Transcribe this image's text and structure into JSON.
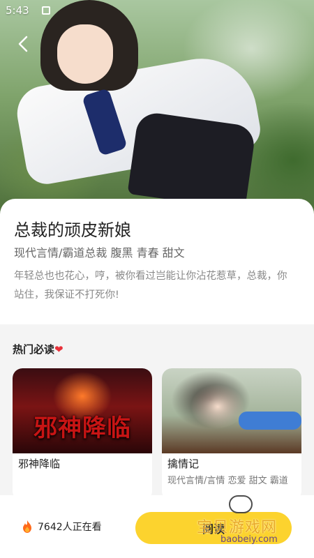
{
  "status_bar": {
    "time": "5:43"
  },
  "book": {
    "title": "总裁的顽皮新娘",
    "tags": "现代言情/霸道总裁 腹黑 青春 甜文",
    "description": "年轻总也也花心，哼，被你看过岂能让你沾花惹草，总裁，你站住，我保证不打死你!"
  },
  "hot": {
    "title": "热门必读",
    "books": [
      {
        "name": "邪神降临",
        "cover_text": "邪神降临",
        "tags": ""
      },
      {
        "name": "擒情记",
        "tags": "现代言情/言情 恋爱 甜文 霸道"
      }
    ]
  },
  "bottom": {
    "viewers": "7642人正在看",
    "read_button": "阅读"
  },
  "watermark": {
    "text": "宝贝游戏网",
    "url": "baobeiy.com"
  },
  "colors": {
    "accent": "#fcd32e",
    "heart": "#e8313a",
    "flame": "#ff6a1a"
  }
}
